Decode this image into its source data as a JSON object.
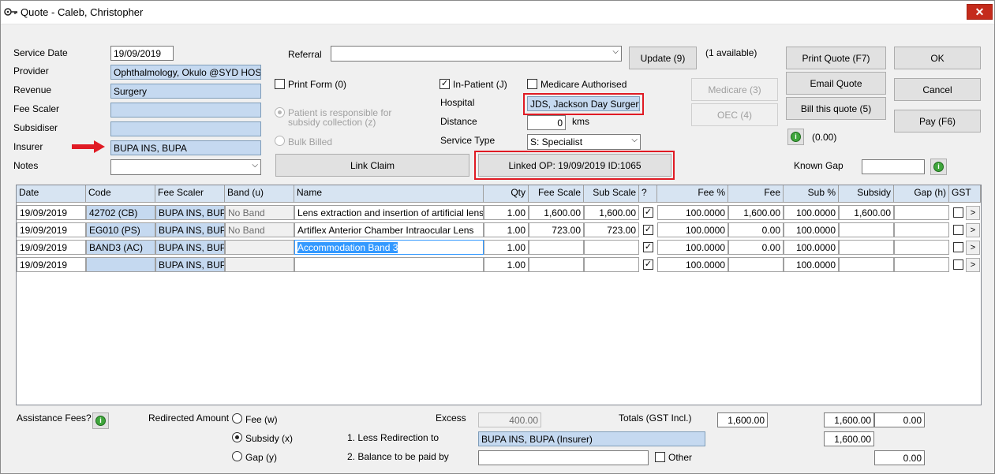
{
  "window": {
    "title": "Quote - Caleb, Christopher",
    "close_label": "✕"
  },
  "left_form": {
    "service_date_label": "Service Date",
    "service_date": "19/09/2019",
    "provider_label": "Provider",
    "provider": "Ophthalmology, Okulo @SYD HOSP",
    "revenue_label": "Revenue",
    "revenue": "Surgery",
    "fee_scaler_label": "Fee Scaler",
    "fee_scaler": "",
    "subsidiser_label": "Subsidiser",
    "subsidiser": "",
    "insurer_label": "Insurer",
    "insurer": "BUPA INS, BUPA",
    "notes_label": "Notes",
    "notes": ""
  },
  "middle": {
    "referral_label": "Referral",
    "referral": "",
    "update_label": "Update (9)",
    "available_text": "(1 available)",
    "print_form_label": "Print Form (0)",
    "patient_responsible_label": "Patient is responsible for subsidy collection (z)",
    "bulk_billed_label": "Bulk Billed",
    "link_claim_label": "Link Claim",
    "in_patient_label": "In-Patient (J)",
    "medicare_authorised_label": "Medicare Authorised",
    "hospital_label": "Hospital",
    "hospital": "JDS, Jackson Day Surgery",
    "distance_label": "Distance",
    "distance": "0",
    "distance_unit": "kms",
    "service_type_label": "Service Type",
    "service_type": "S: Specialist",
    "linked_op_label": "Linked OP: 19/09/2019 ID:1065",
    "medicare_btn_label": "Medicare (3)",
    "oec_btn_label": "OEC (4)"
  },
  "right_buttons": {
    "print_quote": "Print Quote (F7)",
    "email_quote": "Email Quote",
    "bill_quote": "Bill this quote (5)",
    "ok": "OK",
    "cancel": "Cancel",
    "pay": "Pay (F6)",
    "info_amount": "(0.00)",
    "known_gap_label": "Known Gap",
    "known_gap": ""
  },
  "grid": {
    "columns": [
      "Date",
      "Code",
      "Fee Scaler",
      "Band (u)",
      "Name",
      "Qty",
      "Fee Scale",
      "Sub Scale",
      "?",
      "Fee %",
      "Fee",
      "Sub %",
      "Subsidy",
      "Gap (h)",
      "GST"
    ],
    "rows": [
      {
        "date": "19/09/2019",
        "code": "42702 (CB)",
        "fee_scaler": "BUPA INS, BUPA",
        "band": "No Band",
        "name": "Lens extraction and insertion of artificial lens",
        "qty": "1.00",
        "fee_scale": "1,600.00",
        "sub_scale": "1,600.00",
        "q": "✓",
        "fee_pct": "100.0000",
        "fee": "1,600.00",
        "sub_pct": "100.0000",
        "subsidy": "1,600.00",
        "gap": "",
        "gst": "",
        "more": ">"
      },
      {
        "date": "19/09/2019",
        "code": "EG010 (PS)",
        "fee_scaler": "BUPA INS, BUPA",
        "band": "No Band",
        "name": "Artiflex Anterior Chamber Intraocular Lens",
        "qty": "1.00",
        "fee_scale": "723.00",
        "sub_scale": "723.00",
        "q": "✓",
        "fee_pct": "100.0000",
        "fee": "0.00",
        "sub_pct": "100.0000",
        "subsidy": "",
        "gap": "",
        "gst": "",
        "more": ">"
      },
      {
        "date": "19/09/2019",
        "code": "BAND3 (AC)",
        "fee_scaler": "BUPA INS, BUPA",
        "band": "",
        "name": "Accommodation Band 3",
        "qty": "1.00",
        "fee_scale": "",
        "sub_scale": "",
        "q": "✓",
        "fee_pct": "100.0000",
        "fee": "0.00",
        "sub_pct": "100.0000",
        "subsidy": "",
        "gap": "",
        "gst": "",
        "more": ">"
      },
      {
        "date": "19/09/2019",
        "code": "",
        "fee_scaler": "BUPA INS, BUPA",
        "band": "",
        "name": "",
        "qty": "1.00",
        "fee_scale": "",
        "sub_scale": "",
        "q": "✓",
        "fee_pct": "100.0000",
        "fee": "",
        "sub_pct": "100.0000",
        "subsidy": "",
        "gap": "",
        "gst": "",
        "more": ">"
      }
    ]
  },
  "footer": {
    "assistance_fees_label": "Assistance Fees?",
    "redirected_amount_label": "Redirected Amount",
    "fee_radio": "Fee (w)",
    "subsidy_radio": "Subsidy (x)",
    "gap_radio": "Gap (y)",
    "excess_label": "Excess",
    "excess": "400.00",
    "less_redirection_label": "1. Less Redirection to",
    "less_redirection": "BUPA INS, BUPA (Insurer)",
    "balance_label": "2. Balance to be paid by",
    "balance": "",
    "other_label": "Other",
    "totals_label": "Totals (GST Incl.)",
    "total_fee": "1,600.00",
    "total_subsidy": "1,600.00",
    "total_gap": "0.00",
    "redirected_value": "1,600.00",
    "balance_value": "0.00"
  }
}
